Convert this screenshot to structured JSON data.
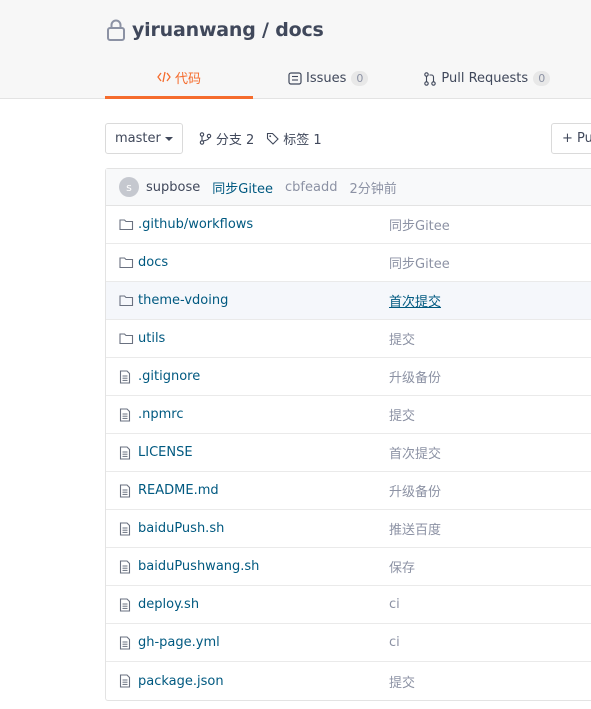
{
  "repo": {
    "title": "yiruanwang / docs"
  },
  "tabs": [
    {
      "label": "代码",
      "active": true
    },
    {
      "label": "Issues",
      "count": "0"
    },
    {
      "label": "Pull Requests",
      "count": "0"
    }
  ],
  "toolbar": {
    "branch": "master",
    "branches_label": "分支 2",
    "tags_label": "标签 1",
    "new_button": "+ Pu"
  },
  "commit": {
    "avatar_letter": "s",
    "author": "supbose",
    "message": "同步Gitee",
    "hash": "cbfeadd",
    "time": "2分钟前"
  },
  "files": [
    {
      "type": "folder",
      "name": ".github/workflows",
      "message": "同步Gitee"
    },
    {
      "type": "folder",
      "name": "docs",
      "message": "同步Gitee"
    },
    {
      "type": "folder",
      "name": "theme-vdoing",
      "message": "首次提交"
    },
    {
      "type": "folder",
      "name": "utils",
      "message": "提交"
    },
    {
      "type": "file",
      "name": ".gitignore",
      "message": "升级备份"
    },
    {
      "type": "file",
      "name": ".npmrc",
      "message": "提交"
    },
    {
      "type": "file",
      "name": "LICENSE",
      "message": "首次提交"
    },
    {
      "type": "file",
      "name": "README.md",
      "message": "升级备份"
    },
    {
      "type": "file",
      "name": "baiduPush.sh",
      "message": "推送百度"
    },
    {
      "type": "file",
      "name": "baiduPushwang.sh",
      "message": "保存"
    },
    {
      "type": "file",
      "name": "deploy.sh",
      "message": "ci"
    },
    {
      "type": "file",
      "name": "gh-page.yml",
      "message": "ci"
    },
    {
      "type": "file",
      "name": "package.json",
      "message": "提交"
    }
  ],
  "colors": {
    "accent": "#f56c2d",
    "link": "#005980",
    "muted": "#8c92a4"
  }
}
